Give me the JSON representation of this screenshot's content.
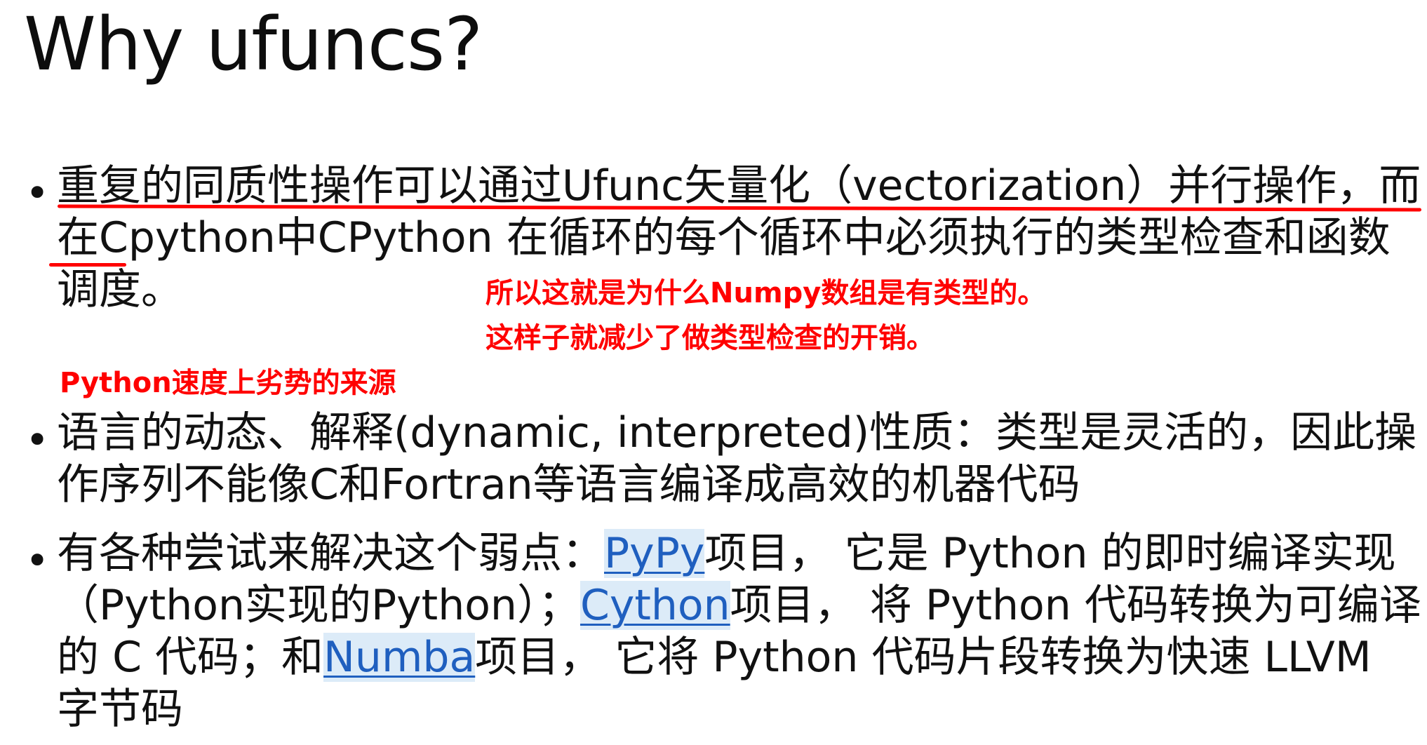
{
  "title": "Why ufuncs?",
  "bullets": [
    {
      "text": "重复的同质性操作可以通过Ufunc矢量化（vectorization）并行操作，而在Cpython中CPython 在循环的每个循环中必须执行的类型检查和函数调度。"
    },
    {
      "text": "语言的动态、解释(dynamic, interpreted)性质：类型是灵活的，因此操作序列不能像C和Fortran等语言编译成高效的机器代码"
    },
    {
      "seg1": "有各种尝试来解决这个弱点：",
      "link1": "PyPy",
      "seg2": "项目， 它是 Python 的即时编译实现（Python实现的Python）；",
      "link2": "Cython",
      "seg3": "项目， 将 Python 代码转换为可编译的 C 代码；和",
      "link3": "Numba",
      "seg4": "项目， 它将 Python 代码片段转换为快速 LLVM 字节码"
    }
  ],
  "annotations": {
    "numpy_note": "所以这就是为什么Numpy数组是有类型的。这样子就减少了做类型检查的开销。",
    "python_source_note": "Python速度上劣势的来源"
  },
  "colors": {
    "annotation": "#ff0000",
    "link": "#1f5fbf",
    "link_highlight": "#dcebf8"
  }
}
